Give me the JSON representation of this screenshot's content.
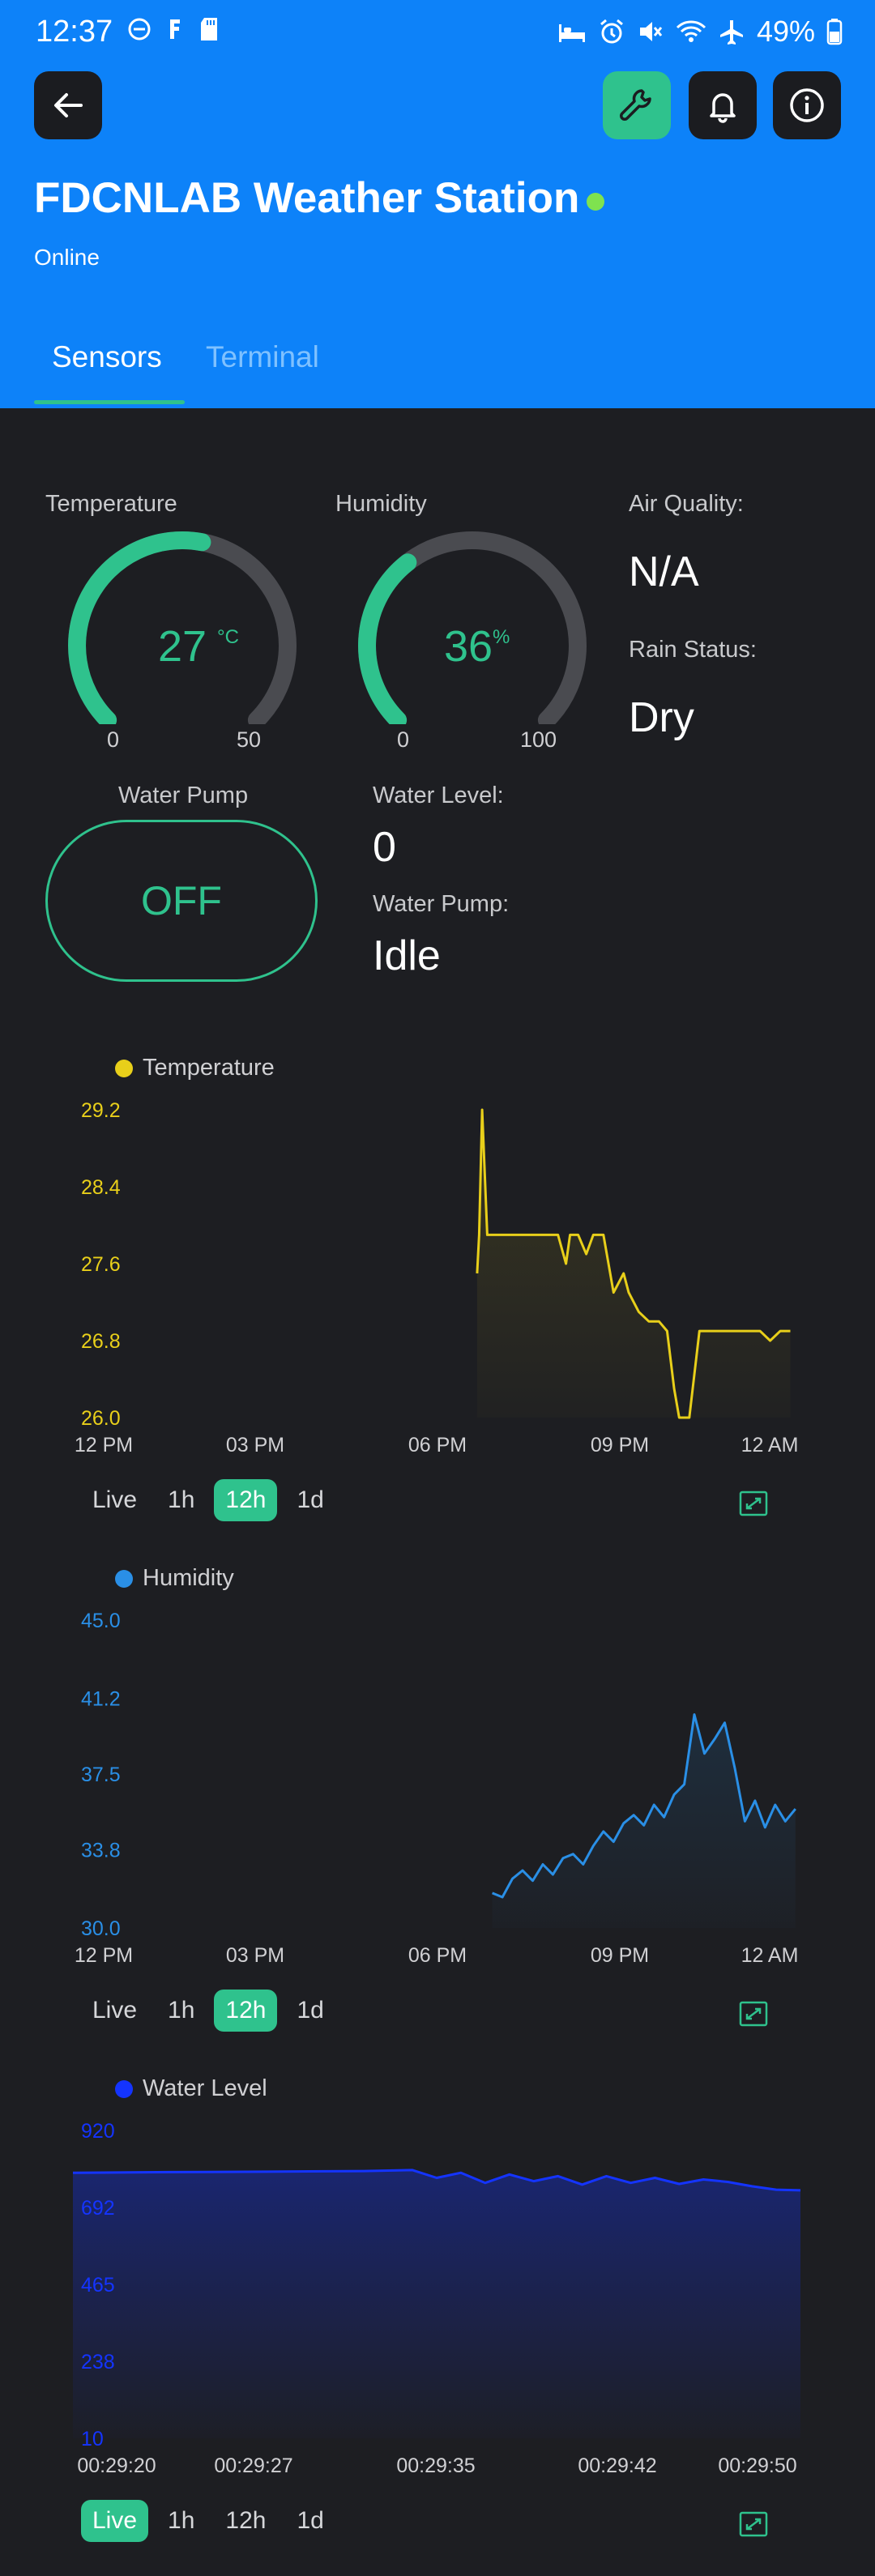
{
  "status_bar": {
    "time": "12:37",
    "battery": "49%"
  },
  "header": {
    "title": "FDCNLAB Weather Station",
    "status": "Online",
    "tabs": [
      {
        "label": "Sensors"
      },
      {
        "label": "Terminal"
      }
    ]
  },
  "sensors": {
    "temperature": {
      "label": "Temperature",
      "value": "27",
      "unit": "°C",
      "min": "0",
      "max": "50",
      "fraction": 0.54
    },
    "humidity": {
      "label": "Humidity",
      "value": "36",
      "unit": "%",
      "min": "0",
      "max": "100",
      "fraction": 0.36
    },
    "air_quality": {
      "label": "Air Quality:",
      "value": "N/A"
    },
    "rain_status": {
      "label": "Rain Status:",
      "value": "Dry"
    },
    "water_pump_control": {
      "label": "Water Pump",
      "value": "OFF"
    },
    "water_level": {
      "label": "Water Level:",
      "value": "0"
    },
    "water_pump_status": {
      "label": "Water Pump:",
      "value": "Idle"
    }
  },
  "colors": {
    "accent": "#2fc28d",
    "header": "#0d82f9",
    "background": "#1d1e22",
    "temperature": "#e8cf1a",
    "humidity": "#2a8fe6",
    "water_level": "#1434ff"
  },
  "range_options": [
    "Live",
    "1h",
    "12h",
    "1d"
  ],
  "chart_data": [
    {
      "type": "area",
      "series": [
        {
          "name": "Temperature",
          "color": "#e8cf1a",
          "x": [
            "18:40",
            "18:42",
            "18:45",
            "18:50",
            "19:05",
            "19:30",
            "19:45",
            "20:00",
            "20:08",
            "20:12",
            "20:20",
            "20:28",
            "20:35",
            "20:45",
            "20:55",
            "21:05",
            "21:10",
            "21:20",
            "21:30",
            "21:40",
            "21:48",
            "21:55",
            "22:00",
            "22:10",
            "22:20",
            "22:30",
            "22:40",
            "22:50",
            "23:00",
            "23:10",
            "23:20",
            "23:30",
            "23:40",
            "23:50"
          ],
          "values": [
            27.5,
            27.9,
            29.2,
            27.9,
            27.9,
            27.9,
            27.9,
            27.9,
            27.6,
            27.9,
            27.9,
            27.7,
            27.9,
            27.9,
            27.3,
            27.5,
            27.3,
            27.1,
            27.0,
            27.0,
            26.9,
            26.3,
            26.0,
            26.0,
            26.9,
            26.9,
            26.9,
            26.9,
            26.9,
            26.9,
            26.9,
            26.8,
            26.9,
            26.9
          ]
        }
      ],
      "x_ticks": [
        "12 PM",
        "03 PM",
        "06 PM",
        "09 PM",
        "12 AM"
      ],
      "y_ticks": [
        "26.0",
        "26.8",
        "27.6",
        "28.4",
        "29.2"
      ],
      "ylim": [
        26.0,
        29.2
      ],
      "range_selected": "12h"
    },
    {
      "type": "area",
      "series": [
        {
          "name": "Humidity",
          "color": "#2a8fe6",
          "x": [
            "18:55",
            "19:05",
            "19:15",
            "19:25",
            "19:35",
            "19:45",
            "19:55",
            "20:05",
            "20:15",
            "20:25",
            "20:35",
            "20:45",
            "20:55",
            "21:05",
            "21:15",
            "21:25",
            "21:35",
            "21:45",
            "21:55",
            "22:05",
            "22:15",
            "22:25",
            "22:35",
            "22:45",
            "22:55",
            "23:05",
            "23:15",
            "23:25",
            "23:35",
            "23:45",
            "23:55"
          ],
          "values": [
            31.7,
            31.5,
            32.4,
            32.8,
            32.3,
            33.1,
            32.6,
            33.4,
            33.6,
            33.1,
            34.0,
            34.7,
            34.2,
            35.1,
            35.5,
            35.0,
            36.0,
            35.4,
            36.5,
            37.0,
            40.4,
            38.5,
            39.2,
            40.0,
            37.8,
            35.2,
            36.2,
            34.9,
            36.0,
            35.2,
            35.8
          ]
        }
      ],
      "x_ticks": [
        "12 PM",
        "03 PM",
        "06 PM",
        "09 PM",
        "12 AM"
      ],
      "y_ticks": [
        "30.0",
        "33.8",
        "37.5",
        "41.2",
        "45.0"
      ],
      "ylim": [
        30.0,
        45.0
      ],
      "range_selected": "12h"
    },
    {
      "type": "area",
      "series": [
        {
          "name": "Water Level",
          "color": "#1434ff",
          "x": [
            "00:29:20",
            "00:29:24",
            "00:29:28",
            "00:29:32",
            "00:29:34",
            "00:29:35",
            "00:29:36",
            "00:29:37",
            "00:29:38",
            "00:29:39",
            "00:29:40",
            "00:29:41",
            "00:29:42",
            "00:29:43",
            "00:29:44",
            "00:29:45",
            "00:29:46",
            "00:29:47",
            "00:29:48",
            "00:29:49",
            "00:29:50"
          ],
          "values": [
            795,
            797,
            798,
            800,
            803,
            780,
            795,
            765,
            790,
            770,
            785,
            760,
            785,
            765,
            780,
            762,
            775,
            768,
            755,
            745,
            743
          ]
        }
      ],
      "x_ticks": [
        "00:29:20",
        "00:29:27",
        "00:29:35",
        "00:29:42",
        "00:29:50"
      ],
      "y_ticks": [
        "10",
        "238",
        "465",
        "692",
        "920"
      ],
      "ylim": [
        10,
        920
      ],
      "range_selected": "Live"
    }
  ]
}
